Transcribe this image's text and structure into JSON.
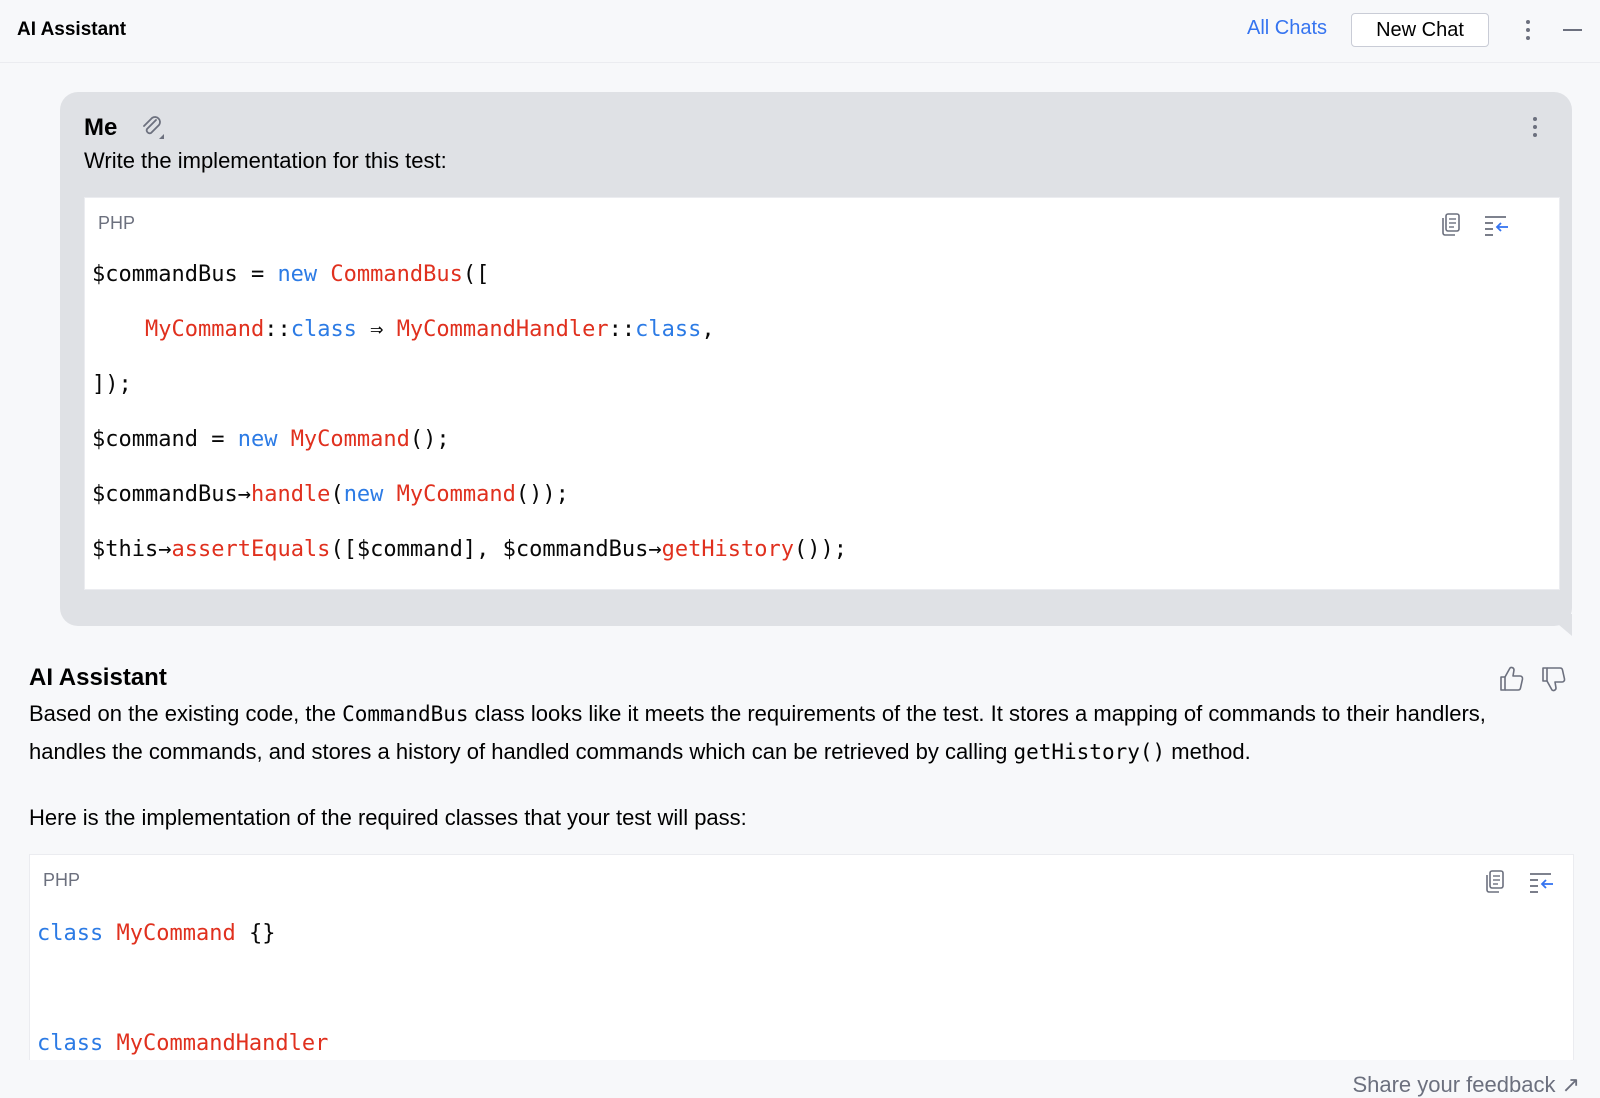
{
  "header": {
    "title": "AI Assistant",
    "all_chats": "All Chats",
    "new_chat": "New Chat"
  },
  "user_message": {
    "author": "Me",
    "text": "Write the implementation for this test:",
    "code": {
      "language": "PHP",
      "lines": [
        [
          {
            "t": "$commandBus = ",
            "c": "plain"
          },
          {
            "t": "new ",
            "c": "kw"
          },
          {
            "t": "CommandBus",
            "c": "cls"
          },
          {
            "t": "([",
            "c": "plain"
          }
        ],
        [
          {
            "t": "    ",
            "c": "plain"
          },
          {
            "t": "MyCommand",
            "c": "cls"
          },
          {
            "t": "::",
            "c": "plain"
          },
          {
            "t": "class",
            "c": "kw"
          },
          {
            "t": " ⇒ ",
            "c": "plain"
          },
          {
            "t": "MyCommandHandler",
            "c": "cls"
          },
          {
            "t": "::",
            "c": "plain"
          },
          {
            "t": "class",
            "c": "kw"
          },
          {
            "t": ",",
            "c": "plain"
          }
        ],
        [
          {
            "t": "]);",
            "c": "plain"
          }
        ],
        [
          {
            "t": "$command = ",
            "c": "plain"
          },
          {
            "t": "new ",
            "c": "kw"
          },
          {
            "t": "MyCommand",
            "c": "cls"
          },
          {
            "t": "();",
            "c": "plain"
          }
        ],
        [
          {
            "t": "$commandBus→",
            "c": "plain"
          },
          {
            "t": "handle",
            "c": "cls"
          },
          {
            "t": "(",
            "c": "plain"
          },
          {
            "t": "new ",
            "c": "kw"
          },
          {
            "t": "MyCommand",
            "c": "cls"
          },
          {
            "t": "());",
            "c": "plain"
          }
        ],
        [
          {
            "t": "$this→",
            "c": "plain"
          },
          {
            "t": "assertEquals",
            "c": "cls"
          },
          {
            "t": "([$command], $commandBus→",
            "c": "plain"
          },
          {
            "t": "getHistory",
            "c": "cls"
          },
          {
            "t": "());",
            "c": "plain"
          }
        ]
      ]
    }
  },
  "assistant_message": {
    "author": "AI Assistant",
    "para1": {
      "t1": "Based on the existing code, the ",
      "code1": "CommandBus",
      "t2": " class looks like it meets the requirements of the test. It stores a mapping of commands to their handlers, handles the commands, and stores a history of handled commands which can be retrieved by calling ",
      "code2": "getHistory()",
      "t3": " method."
    },
    "para2": "Here is the implementation of the required classes that your test will pass:",
    "code": {
      "language": "PHP",
      "lines": [
        [
          {
            "t": "class ",
            "c": "kw"
          },
          {
            "t": "MyCommand",
            "c": "cls"
          },
          {
            "t": " {}",
            "c": "plain"
          }
        ],
        [
          {
            "t": "",
            "c": "plain"
          }
        ],
        [
          {
            "t": "class ",
            "c": "kw"
          },
          {
            "t": "MyCommandHandler",
            "c": "cls"
          }
        ]
      ]
    }
  },
  "footer": {
    "feedback": "Share your feedback ↗"
  },
  "colors": {
    "accent": "#3574f0",
    "keyword": "#2c7be5",
    "class_name": "#e0301e",
    "bubble": "#dfe1e5",
    "background": "#f7f8fa"
  }
}
